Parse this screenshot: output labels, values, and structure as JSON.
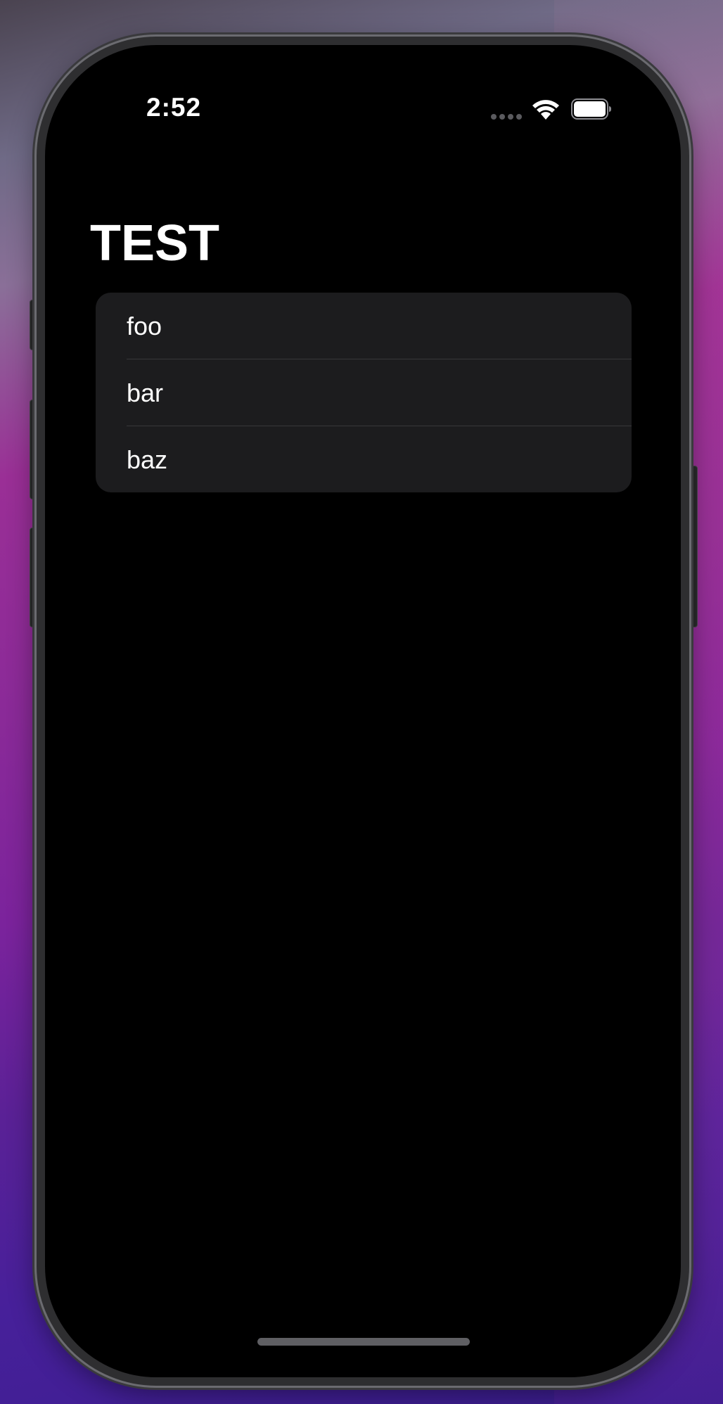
{
  "status_bar": {
    "time": "2:52",
    "icons": [
      "signal-dots-icon",
      "wifi-icon",
      "battery-icon"
    ]
  },
  "navigation": {
    "title": "TEST"
  },
  "list": {
    "items": [
      {
        "label": "foo"
      },
      {
        "label": "bar"
      },
      {
        "label": "baz"
      }
    ]
  },
  "colors": {
    "screen_background": "#000000",
    "card_background": "#1c1c1e",
    "separator": "#38383a",
    "text_primary": "#ffffff"
  }
}
